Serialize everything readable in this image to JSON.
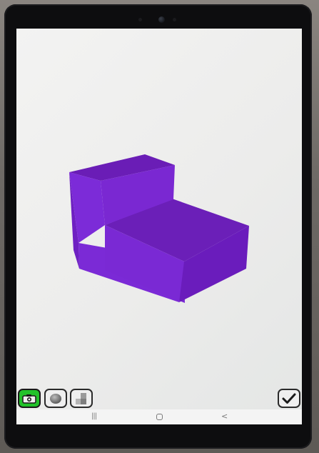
{
  "app": {
    "shape_colors": {
      "top": "#6b1fb8",
      "front": "#7b2ad6",
      "side": "#6a1cbc",
      "accent": "#22c22a"
    }
  },
  "toolbar": {
    "camera_icon": "camera-icon",
    "sphere_icon": "sphere-icon",
    "shape_icon": "shape-icon",
    "confirm_icon": "checkmark-icon",
    "active_tool": "camera"
  },
  "navigation": {
    "recents_label": "|||",
    "home_icon": "home-icon",
    "back_label": "<"
  }
}
